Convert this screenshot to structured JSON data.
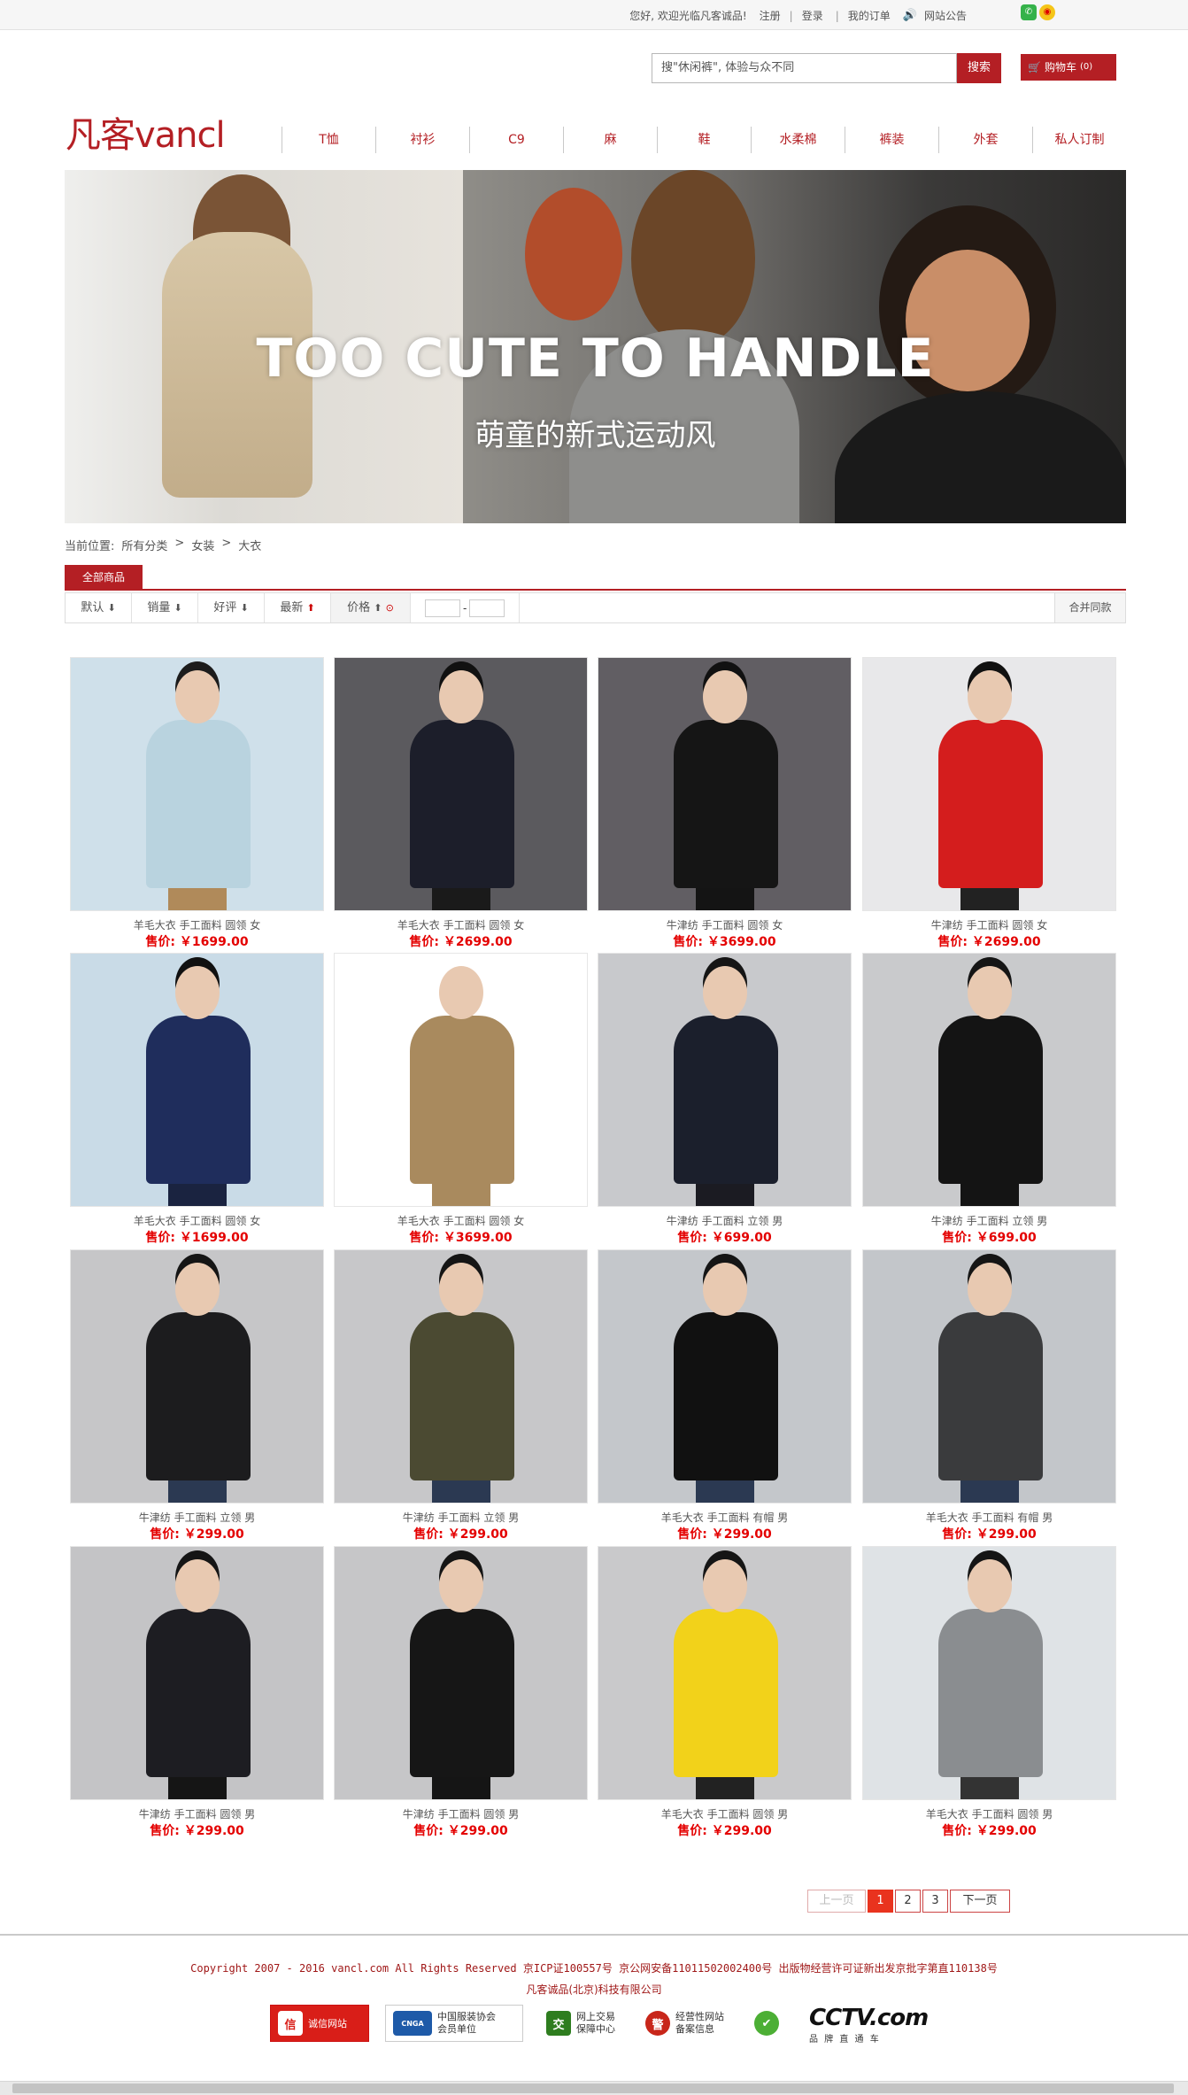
{
  "topbar": {
    "greeting": "您好, 欢迎光临凡客诚品!",
    "register": "注册",
    "sep1": "|",
    "login": "登录",
    "sep2": "|",
    "orders": "我的订单",
    "notice": "网站公告"
  },
  "search": {
    "placeholder": "搜\"休闲裤\", 体验与众不同",
    "button": "搜索"
  },
  "cart": {
    "label": "购物车",
    "count": "(0)"
  },
  "logo": "凡客vancl",
  "nav": [
    "T恤",
    "衬衫",
    "C9",
    "麻",
    "鞋",
    "水柔棉",
    "裤装",
    "外套",
    "私人订制"
  ],
  "banner": {
    "headline": "TOO CUTE TO HANDLE",
    "sub": "萌童的新式运动风"
  },
  "breadcrumb": [
    "当前位置:",
    "所有分类",
    ">",
    "女装",
    ">",
    "大衣"
  ],
  "tab": "全部商品",
  "sort": {
    "default": "默认",
    "sales": "销量",
    "rating": "好评",
    "newest": "最新",
    "price": "价格",
    "merge": "合并同款"
  },
  "products": [
    {
      "title": "羊毛大衣 手工面料 圆领 女",
      "price": "售价: ￥1699.00",
      "bg": "#cfe0ea",
      "cloth": "#b9d3df",
      "hair": "#1c1c1c",
      "legs": "#b08a5a"
    },
    {
      "title": "羊毛大衣 手工面料 圆领 女",
      "price": "售价: ￥2699.00",
      "bg": "#5b5a5e",
      "cloth": "#1c1e2a",
      "hair": "#111",
      "legs": "#1a1a1a"
    },
    {
      "title": "牛津纺 手工面料 圆领 女",
      "price": "售价: ￥3699.00",
      "bg": "#615e63",
      "cloth": "#151515",
      "hair": "#111",
      "legs": "#141414"
    },
    {
      "title": "牛津纺 手工面料 圆领 女",
      "price": "售价: ￥2699.00",
      "bg": "#e8e8ea",
      "cloth": "#d41d1d",
      "hair": "#111",
      "legs": "#222"
    },
    {
      "title": "羊毛大衣 手工面料 圆领 女",
      "price": "售价: ￥1699.00",
      "bg": "#c9dbe7",
      "cloth": "#1f2d5c",
      "hair": "#111",
      "legs": "#1a2340"
    },
    {
      "title": "羊毛大衣 手工面料 圆领 女",
      "price": "售价: ￥3699.00",
      "bg": "#ffffff",
      "cloth": "#a98a5e",
      "hair": "#ffffff",
      "legs": "#a98a5e"
    },
    {
      "title": "牛津纺 手工面料 立领 男",
      "price": "售价: ￥699.00",
      "bg": "#c8c9cc",
      "cloth": "#1b1f2c",
      "hair": "#151515",
      "legs": "#1b1b22"
    },
    {
      "title": "牛津纺 手工面料 立领 男",
      "price": "售价: ￥699.00",
      "bg": "#c9cacc",
      "cloth": "#141414",
      "hair": "#151515",
      "legs": "#141414"
    },
    {
      "title": "牛津纺 手工面料 立领 男",
      "price": "售价: ￥299.00",
      "bg": "#c6c6c8",
      "cloth": "#1c1c1e",
      "hair": "#151515",
      "legs": "#2b3952"
    },
    {
      "title": "牛津纺 手工面料 立领 男",
      "price": "售价: ￥299.00",
      "bg": "#c7c7c9",
      "cloth": "#4b4a32",
      "hair": "#151515",
      "legs": "#2b3952"
    },
    {
      "title": "羊毛大衣 手工面料 有帽 男",
      "price": "售价: ￥299.00",
      "bg": "#c4c7cb",
      "cloth": "#111111",
      "hair": "#151515",
      "legs": "#2b3952"
    },
    {
      "title": "羊毛大衣 手工面料 有帽 男",
      "price": "售价: ￥299.00",
      "bg": "#c3c6ca",
      "cloth": "#3a3b3d",
      "hair": "#151515",
      "legs": "#2b3952"
    },
    {
      "title": "牛津纺 手工面料 圆领 男",
      "price": "售价: ￥299.00",
      "bg": "#c4c4c6",
      "cloth": "#1d1d22",
      "hair": "#151515",
      "legs": "#151515"
    },
    {
      "title": "牛津纺 手工面料 圆领 男",
      "price": "售价: ￥299.00",
      "bg": "#c6c6c8",
      "cloth": "#161616",
      "hair": "#151515",
      "legs": "#151515"
    },
    {
      "title": "羊毛大衣 手工面料 圆领 男",
      "price": "售价: ￥299.00",
      "bg": "#c9c9cb",
      "cloth": "#f2d21a",
      "hair": "#151515",
      "legs": "#222"
    },
    {
      "title": "羊毛大衣 手工面料 圆领 男",
      "price": "售价: ￥299.00",
      "bg": "#dfe3e6",
      "cloth": "#8a8d90",
      "hair": "#151515",
      "legs": "#333"
    }
  ],
  "pager": {
    "prev": "上一页",
    "pages": [
      "1",
      "2",
      "3"
    ],
    "next": "下一页"
  },
  "footer": {
    "copyright": "Copyright 2007 - 2016 vancl.com All Rights Reserved 京ICP证100557号 京公网安备11011502002400号 出版物经营许可证新出发京批字第直110138号",
    "company": "凡客诚品(北京)科技有限公司",
    "badges": {
      "credit_icon": "信",
      "credit": "诚信网站",
      "cnga_icon": "CNGA",
      "cnga1": "中国服装协会",
      "cnga2": "会员单位",
      "trade_icon": "交",
      "trade1": "网上交易",
      "trade2": "保障中心",
      "police_icon": "警",
      "police1": "经营性网站",
      "police2": "备案信息",
      "cctv": "CCTV.com",
      "cctv_sub": "品 牌 直 通 车"
    }
  }
}
